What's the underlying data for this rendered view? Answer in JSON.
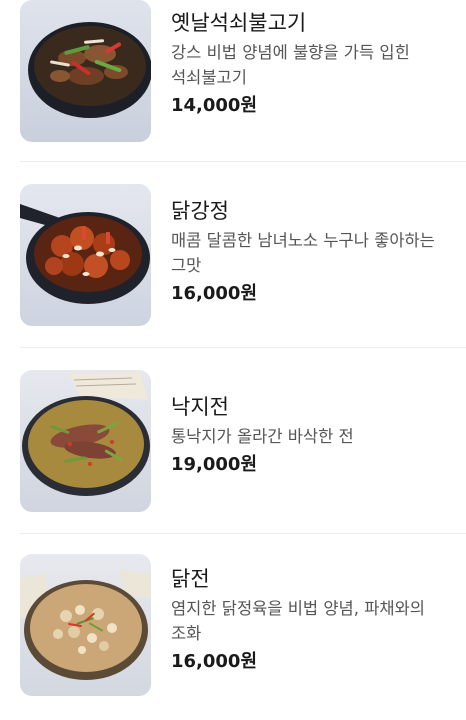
{
  "menu": {
    "items": [
      {
        "name": "옛날석쇠불고기",
        "description": "강스 비법 양념에 불향을 가득 입힌 석쇠불고기",
        "price": "14,000원",
        "image_icon": "bulgogi-dish-photo"
      },
      {
        "name": "닭강정",
        "description": "매콤 달콤한 남녀노소 누구나 좋아하는 그맛",
        "price": "16,000원",
        "image_icon": "fried-chicken-dish-photo"
      },
      {
        "name": "낙지전",
        "description": "통낙지가 올라간 바삭한 전",
        "price": "19,000원",
        "image_icon": "octopus-pancake-photo"
      },
      {
        "name": "닭전",
        "description": "염지한 닭정육을 비법 양념, 파채와의 조화",
        "price": "16,000원",
        "image_icon": "chicken-pancake-photo"
      }
    ]
  },
  "colors": {
    "text_primary": "#1a1a1a",
    "text_secondary": "#555555",
    "divider": "#ececec",
    "background": "#ffffff"
  }
}
